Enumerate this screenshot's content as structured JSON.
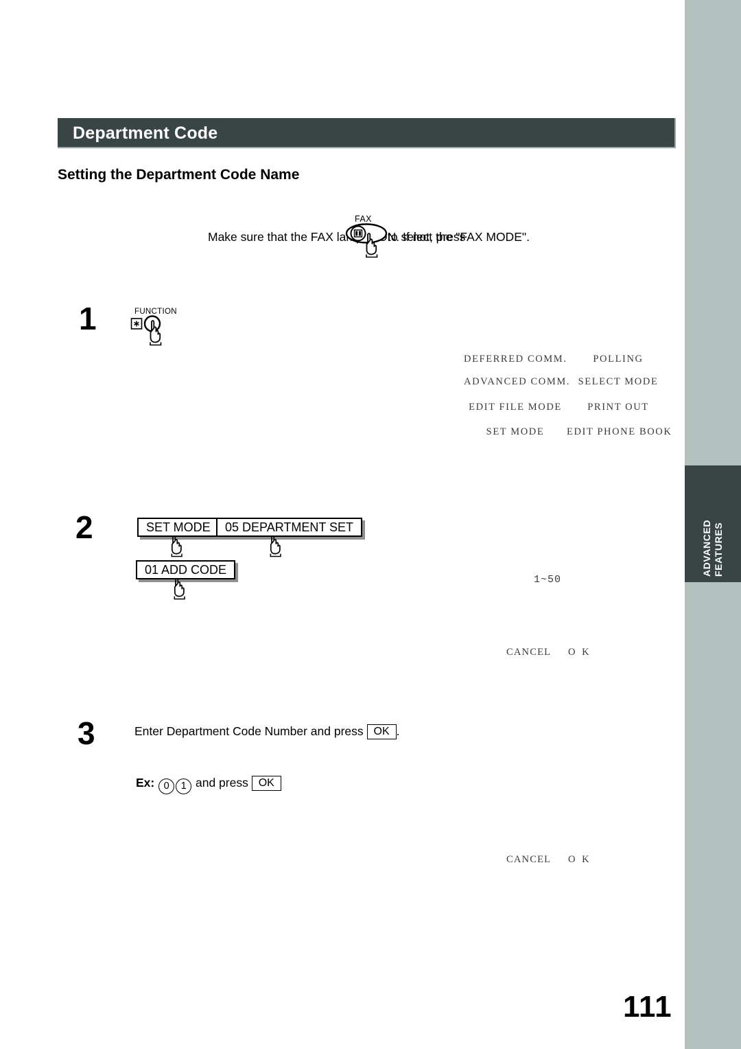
{
  "page": {
    "section_title": "Department Code",
    "sub_heading": "Setting the Department Code Name",
    "page_number": "111",
    "colors": {
      "header_bar": "#394444",
      "binding_band": "#b3c2bf",
      "side_tab": "#394444",
      "text": "#000000",
      "lcd_text": "#3a3a3a"
    }
  },
  "intro": {
    "text_before_key": "Make sure that the FAX lamp is ON.  If not, press",
    "text_after_key": "to select the \"FAX MODE\".",
    "key_label": "FAX",
    "key_icon": "fax-key-icon",
    "hand_icon": "pointing-hand-icon"
  },
  "steps": [
    {
      "number": "1",
      "key_label": "FUNCTION",
      "key_icon": "function-round-key-icon",
      "star_icon": "asterisk-key-icon",
      "hand_icon": "pointing-hand-icon"
    },
    {
      "number": "2",
      "buttons": [
        {
          "label": "SET MODE",
          "name": "set-mode-button"
        },
        {
          "label": "05 DEPARTMENT SET",
          "name": "department-set-button"
        },
        {
          "label": "01 ADD CODE",
          "name": "add-code-button"
        }
      ]
    },
    {
      "number": "3",
      "instruction_before": "Enter Department Code Number and press",
      "instruction_ok": "OK",
      "instruction_after": ".",
      "example_label": "Ex:",
      "example_keys": [
        "0",
        "1"
      ],
      "example_middle": "and press",
      "example_ok": "OK"
    }
  ],
  "lcd_panels": [
    {
      "name": "function-menu-display",
      "rows": [
        {
          "left": "DEFERRED COMM.",
          "right": "POLLING"
        },
        {
          "left": "ADVANCED COMM.",
          "right": "SELECT MODE"
        },
        {
          "left": "EDIT FILE MODE",
          "right": "PRINT OUT"
        },
        {
          "left": "SET MODE",
          "right": "EDIT PHONE BOOK"
        }
      ]
    },
    {
      "name": "department-code-entry-display",
      "range": "1~50",
      "cancel": "CANCEL",
      "ok": "O K"
    },
    {
      "name": "department-code-name-display",
      "cancel": "CANCEL",
      "ok": "O K"
    }
  ],
  "side_tab": {
    "line1": "ADVANCED",
    "line2": "FEATURES"
  }
}
